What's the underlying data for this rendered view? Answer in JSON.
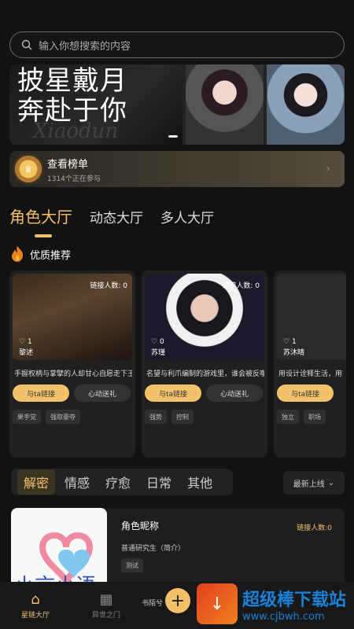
{
  "search": {
    "placeholder": "输入你想搜索的内容"
  },
  "banner": {
    "title_line1": "披星戴月",
    "title_line2": "奔赴于你",
    "deco_text": "Xiaodun"
  },
  "rank": {
    "title": "查看榜单",
    "subtitle": "1314个正在参与"
  },
  "tabs": [
    {
      "label": "角色大厅",
      "active": true
    },
    {
      "label": "动态大厅"
    },
    {
      "label": "多人大厅"
    }
  ],
  "section": {
    "title": "优质推荐"
  },
  "cards": [
    {
      "count": "链接人数: 0",
      "likes": "1",
      "name": "黎述",
      "desc": "手握权柄与掌擘的人却甘心自愿走下王",
      "link_label": "与ta链接",
      "move_label": "心动送礼",
      "tags": [
        "果手党",
        "强取豪夺"
      ]
    },
    {
      "count": "链接人数: 0",
      "likes": "0",
      "name": "苏瑾",
      "desc": "名望与利爪编制的游戏里，谁会被反噬",
      "link_label": "与ta链接",
      "move_label": "心动送礼",
      "tags": [
        "强势",
        "控制"
      ]
    },
    {
      "count": "",
      "likes": "1",
      "name": "苏沐晴",
      "desc": "用设计诠释生活，用实",
      "link_label": "与ta链接",
      "move_label": "",
      "tags": [
        "独立",
        "职场"
      ]
    }
  ],
  "filters": [
    {
      "label": "解密",
      "active": true
    },
    {
      "label": "情感"
    },
    {
      "label": "疗愈"
    },
    {
      "label": "日常"
    },
    {
      "label": "其他"
    }
  ],
  "sort": {
    "label": "最新上线"
  },
  "list_item": {
    "name": "角色昵称",
    "count": "链接人数:0",
    "intro": "普通研究生（简介）",
    "tag": "测试",
    "thumb_text": "小言小语"
  },
  "nav": {
    "home": "星链大厅",
    "world": "异世之门",
    "side_text": "书陌兮"
  },
  "watermark": {
    "title": "超级棒下载站",
    "url": "www.cjbwh.com"
  },
  "colors": {
    "accent": "#f4c16b",
    "background": "#121212"
  }
}
